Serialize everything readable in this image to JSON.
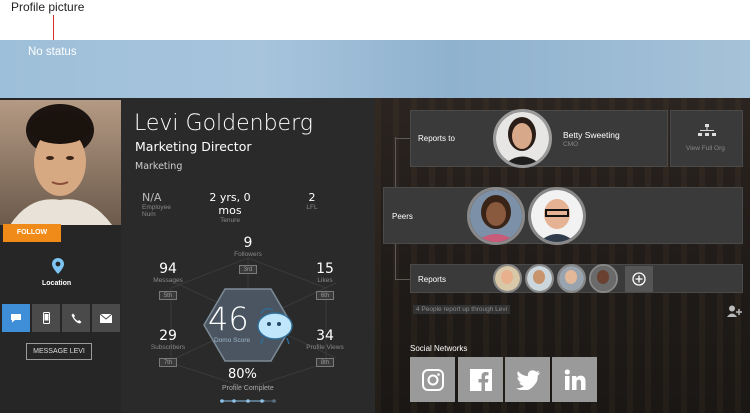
{
  "annotation": {
    "label": "Profile picture"
  },
  "banner": {
    "status": "No status"
  },
  "profile": {
    "name": "Levi Goldenberg",
    "job_title": "Marketing Director",
    "department": "Marketing",
    "follow_label": "FOLLOW",
    "location_label": "Location",
    "message_label": "MESSAGE LEVI"
  },
  "info": [
    {
      "value": "N/A",
      "label": "Employee Num"
    },
    {
      "value": "2 yrs, 0 mos",
      "label": "Tenure"
    },
    {
      "value": "2",
      "label": "LFL"
    }
  ],
  "stats": {
    "followers": {
      "value": "9",
      "label": "Followers",
      "rank": "3rd"
    },
    "messages": {
      "value": "94",
      "label": "Messages",
      "rank": "5th"
    },
    "likes": {
      "value": "15",
      "label": "Likes",
      "rank": "6th"
    },
    "subscribers": {
      "value": "29",
      "label": "Subscribers",
      "rank": "7th"
    },
    "profile_views": {
      "value": "34",
      "label": "Profile Views",
      "rank": "8th"
    }
  },
  "score": {
    "value": "46",
    "label": "Domo Score"
  },
  "completion": {
    "value": "80%",
    "label": "Profile Complete",
    "fraction": 0.8
  },
  "org": {
    "reports_to_label": "Reports to",
    "manager_name": "Betty Sweeting",
    "manager_title": "CMO",
    "view_full_org": "View Full Org",
    "peers_label": "Peers",
    "reports_label": "Reports",
    "reports_note": "4 People report up through Levi"
  },
  "social": {
    "title": "Social Networks",
    "networks": [
      "instagram",
      "facebook",
      "twitter",
      "linkedin"
    ]
  },
  "colors": {
    "accent": "#f08a19",
    "active_tab": "#3f8fd8",
    "connector": "#e0483c"
  }
}
